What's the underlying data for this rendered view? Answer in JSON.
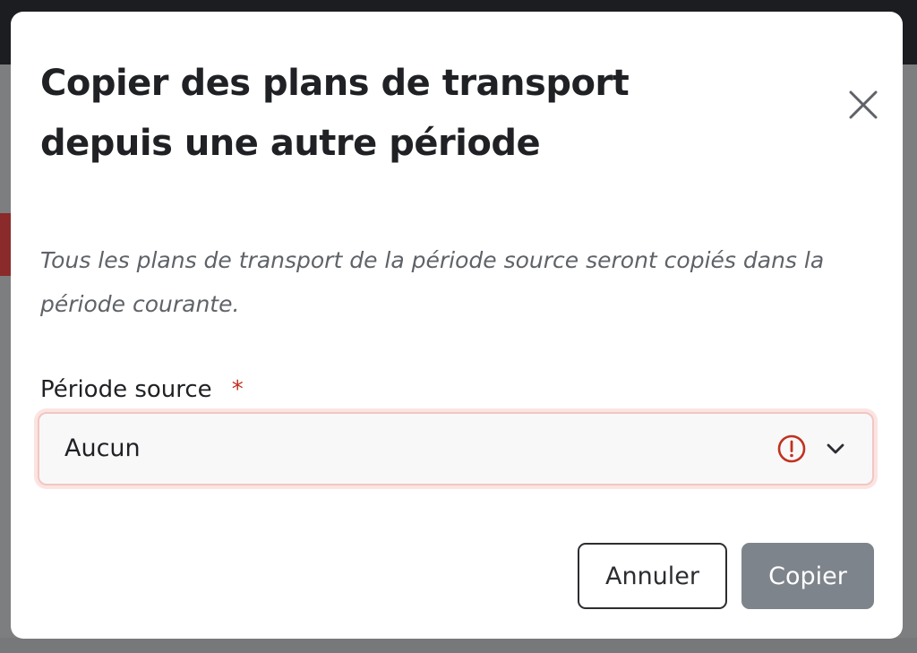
{
  "dialog": {
    "title": "Copier des plans de transport\ndepuis une autre période",
    "description": "Tous les plans de transport de la période source seront copiés dans la période courante.",
    "close_icon": "close-icon"
  },
  "form": {
    "source_period": {
      "label": "Période source",
      "required_marker": "*",
      "selected_value": "Aucun",
      "status_icon": "error-icon",
      "dropdown_icon": "chevron-down-icon"
    }
  },
  "actions": {
    "cancel_label": "Annuler",
    "submit_label": "Copier"
  },
  "colors": {
    "required": "#c0321f",
    "error": "#c0321f",
    "submit_disabled_bg": "#7e848c",
    "field_error_border": "#f2c6c3"
  }
}
